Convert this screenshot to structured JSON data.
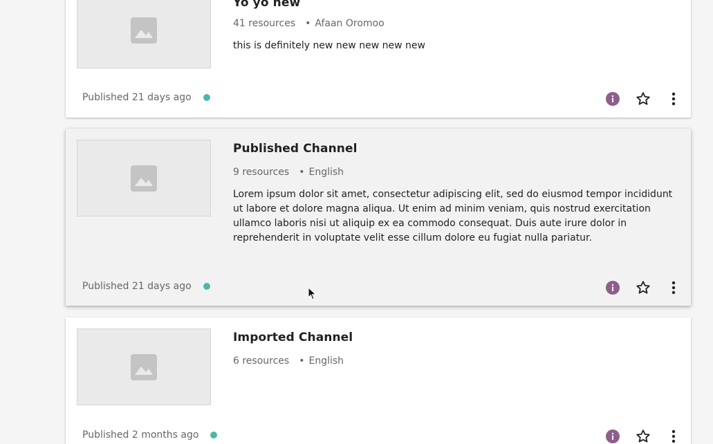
{
  "colors": {
    "info_icon": "#8e5e8c",
    "status_published": "#4db6ac",
    "thumbnail_bg": "#eaeaea",
    "thumbnail_icon": "#c4c4c4"
  },
  "channels": [
    {
      "title": "Yo yo new",
      "resources": "41 resources",
      "language": "Afaan Oromoo",
      "description": "this is definitely new new new new new",
      "published": "Published 21 days ago",
      "thumbnail_icon": "image-placeholder-icon",
      "actions": [
        "info-icon",
        "star-outline-icon",
        "more-vert-icon"
      ]
    },
    {
      "title": "Published Channel",
      "resources": "9 resources",
      "language": "English",
      "description": "Lorem ipsum dolor sit amet, consectetur adipiscing elit, sed do eiusmod tempor incididunt ut labore et dolore magna aliqua. Ut enim ad minim veniam, quis nostrud exercitation ullamco laboris nisi ut aliquip ex ea commodo consequat. Duis aute irure dolor in reprehenderit in voluptate velit esse cillum dolore eu fugiat nulla pariatur.",
      "published": "Published 21 days ago",
      "thumbnail_icon": "image-placeholder-icon",
      "actions": [
        "info-icon",
        "star-outline-icon",
        "more-vert-icon"
      ]
    },
    {
      "title": "Imported Channel",
      "resources": "6 resources",
      "language": "English",
      "description": "",
      "published": "Published 2 months ago",
      "thumbnail_icon": "image-placeholder-icon",
      "actions": [
        "info-icon",
        "star-outline-icon",
        "more-vert-icon"
      ]
    }
  ],
  "separator": "•"
}
